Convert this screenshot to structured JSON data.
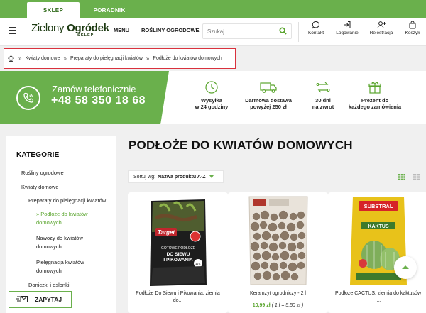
{
  "top_tabs": [
    {
      "label": "SKLEP"
    },
    {
      "label": "PORADNIK"
    }
  ],
  "header": {
    "logo_main_a": "Zielony ",
    "logo_main_b": "Ogródek",
    "logo_sub": "SKLEP",
    "menu_label": "MENU",
    "plants_label": "ROŚLINY OGRODOWE",
    "search_placeholder": "Szukaj",
    "icons": {
      "kontakt": "Kontakt",
      "logowanie": "Logowanie",
      "rejestracja": "Rejestracja",
      "koszyk": "Koszyk"
    }
  },
  "breadcrumb": {
    "items": [
      "Kwiaty domowe",
      "Preparaty do pielęgnacji kwiatów",
      "Podłoże do kwiatów domowych"
    ],
    "separator": "»"
  },
  "promo": {
    "line1": "Zamów telefonicznie",
    "phone": "+48 58 350 18 68",
    "features": [
      {
        "line1": "Wysyłka",
        "line2": "w 24 godziny"
      },
      {
        "line1": "Darmowa dostawa",
        "line2": "powyżej 250 zł"
      },
      {
        "line1": "30 dni",
        "line2": "na zwrot"
      },
      {
        "line1": "Prezent do",
        "line2": "każdego zamówienia"
      }
    ]
  },
  "sidebar": {
    "title": "KATEGORIE",
    "items": [
      {
        "label": "Rośliny ogrodowe"
      },
      {
        "label": "Kwiaty domowe"
      },
      {
        "label": "Preparaty do pielęgnacji kwiatów"
      },
      {
        "line1": "» Podłoże do kwiatów",
        "line2": "domowych"
      },
      {
        "line1": "Nawozy do kwiatów",
        "line2": "domowych"
      },
      {
        "line1": "Pielęgnacja kwiatów",
        "line2": "domowych"
      },
      {
        "label": "Doniczki i osłonki"
      }
    ]
  },
  "zapytaj_label": "ZAPYTAJ",
  "main": {
    "title": "PODŁOŻE DO KWIATÓW DOMOWYCH",
    "sort_prefix": "Sortuj wg:",
    "sort_value": "Nazwa produktu A-Z"
  },
  "products": [
    {
      "name_line1": "Podłoże Do Siewu i Pikowania, ziemia",
      "name_line2": "do...",
      "bag_brand": "Target",
      "bag_line1": "GOTOWE PODŁOŻE",
      "bag_line2": "DO SIEWU",
      "bag_line3": "I PIKOWANIA",
      "bag_vol": "20 L"
    },
    {
      "name_line1": "Keramzyt ogrodniczy - 2 l",
      "price": "10,99 zł",
      "unit_price": "( 1 l = 5,50 zł )"
    },
    {
      "name_line1": "Podłoże CACTUS, ziemia do kaktusów",
      "name_line2": "i...",
      "bag_brand": "SUBSTRAL",
      "bag_line1": "KAKTUS"
    }
  ],
  "colors": {
    "brand_green": "#6ab04c",
    "active_link": "#5aa52e",
    "highlight_red": "#d9313d"
  }
}
